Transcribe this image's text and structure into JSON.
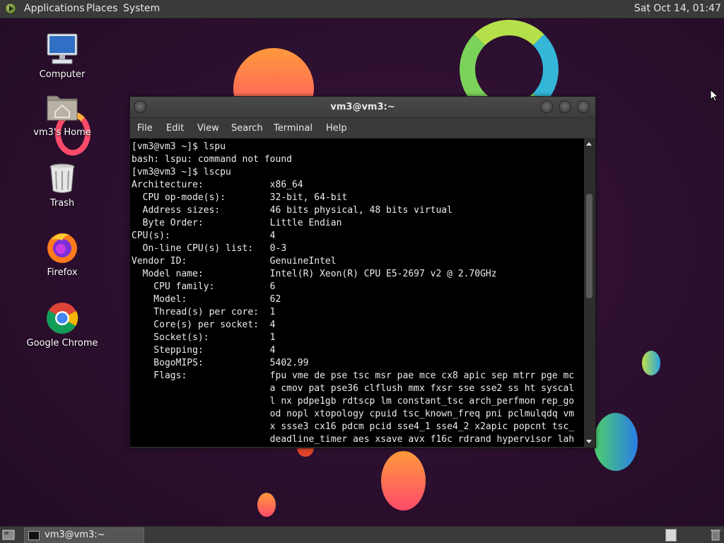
{
  "top_panel": {
    "menus": [
      "Applications",
      "Places",
      "System"
    ],
    "clock": "Sat Oct 14, 01:47"
  },
  "desktop_icons": [
    {
      "label": "Computer",
      "icon": "computer-icon"
    },
    {
      "label": "vm3's Home",
      "icon": "home-folder-icon"
    },
    {
      "label": "Trash",
      "icon": "trash-icon"
    },
    {
      "label": "Firefox",
      "icon": "firefox-icon"
    },
    {
      "label": "Google Chrome",
      "icon": "chrome-icon"
    }
  ],
  "terminal": {
    "title": "vm3@vm3:~",
    "menu": [
      "File",
      "Edit",
      "View",
      "Search",
      "Terminal",
      "Help"
    ],
    "lines": [
      "[vm3@vm3 ~]$ lspu",
      "bash: lspu: command not found",
      "[vm3@vm3 ~]$ lscpu",
      "Architecture:            x86_64",
      "  CPU op-mode(s):        32-bit, 64-bit",
      "  Address sizes:         46 bits physical, 48 bits virtual",
      "  Byte Order:            Little Endian",
      "CPU(s):                  4",
      "  On-line CPU(s) list:   0-3",
      "Vendor ID:               GenuineIntel",
      "  Model name:            Intel(R) Xeon(R) CPU E5-2697 v2 @ 2.70GHz",
      "    CPU family:          6",
      "    Model:               62",
      "    Thread(s) per core:  1",
      "    Core(s) per socket:  4",
      "    Socket(s):           1",
      "    Stepping:            4",
      "    BogoMIPS:            5402.99",
      "    Flags:               fpu vme de pse tsc msr pae mce cx8 apic sep mtrr pge mc",
      "                         a cmov pat pse36 clflush mmx fxsr sse sse2 ss ht syscal",
      "                         l nx pdpe1gb rdtscp lm constant_tsc arch_perfmon rep_go",
      "                         od nopl xtopology cpuid tsc_known_freq pni pclmulqdq vm",
      "                         x ssse3 cx16 pdcm pcid sse4_1 sse4_2 x2apic popcnt tsc_",
      "                         deadline_timer aes xsave avx f16c rdrand hypervisor lah"
    ]
  },
  "bottom_panel": {
    "task_label": "vm3@vm3:~"
  }
}
